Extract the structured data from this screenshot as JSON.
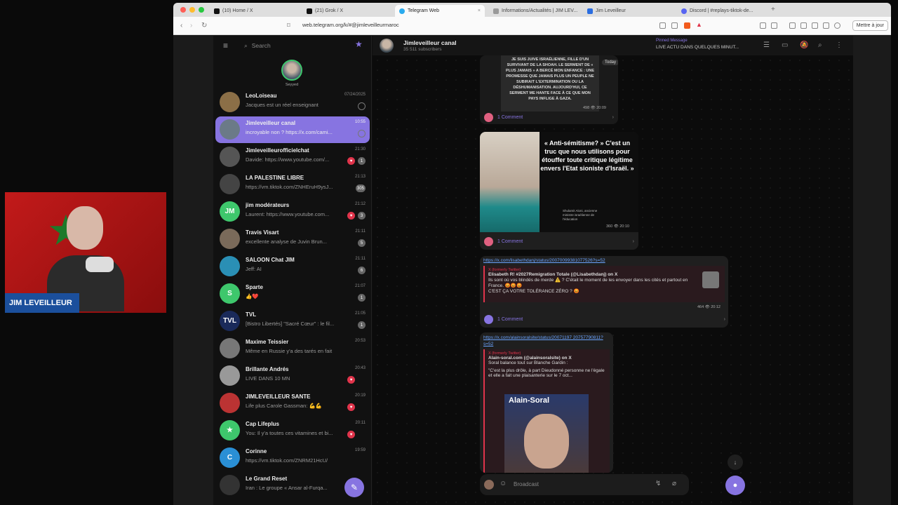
{
  "browser": {
    "tabs": [
      {
        "label": "(10) Home / X"
      },
      {
        "label": "(21) Grok / X"
      },
      {
        "label": "Telegram Web"
      },
      {
        "label": "Informations/Actualités | JIM LEV..."
      },
      {
        "label": "Jim Leveilleur"
      },
      {
        "label": "Discord | #replays-tiktok-de..."
      }
    ],
    "url": "web.telegram.org/k/#@jimleveilleurmaroc",
    "update_label": "Mettre à jour"
  },
  "sidebar": {
    "search_placeholder": "Search",
    "story_label": "Seyyed",
    "chats": [
      {
        "name": "LeoLoiseau",
        "preview": "Jacques est un réel enseignant",
        "time": "07/24/2025",
        "avatar_bg": "#8b6f47",
        "initials": ""
      },
      {
        "name": "Jimleveilleur canal",
        "preview": "incroyable non ? https://x.com/cami...",
        "time": "10:55",
        "avatar_bg": "#6b7a88",
        "initials": ""
      },
      {
        "name": "Jimleveilleurofficielchat",
        "preview": "Davide: https://www.youtube.com/...",
        "time": "21:30",
        "badge": "1",
        "avatar_bg": "#555",
        "initials": ""
      },
      {
        "name": "LA PALESTINE LIBRE",
        "preview": "https://vm.tiktok.com/ZNHEruH9ysJ...",
        "time": "21:13",
        "badge": "305",
        "avatar_bg": "#444",
        "initials": ""
      },
      {
        "name": "jim modérateurs",
        "preview": "Laurent: https://www.youtube.com...",
        "time": "21:12",
        "badge": "3",
        "avatar_bg": "#3ec76c",
        "initials": "JM"
      },
      {
        "name": "Travis Visart",
        "preview": "excellente analyse de Juvin Brun...",
        "time": "21:11",
        "badge": "5",
        "avatar_bg": "#7a6a5a",
        "initials": ""
      },
      {
        "name": "SALOON Chat JIM",
        "preview": "Jeff: AI",
        "time": "21:11",
        "badge": "6",
        "avatar_bg": "#2a8fb5",
        "initials": ""
      },
      {
        "name": "Sparte",
        "preview": "👍❤️",
        "time": "21:07",
        "badge": "1",
        "avatar_bg": "#3ec76c",
        "initials": "S"
      },
      {
        "name": "TVL",
        "preview": "[Bistro Libertés] \"Sacré Cœur\" : le fil...",
        "time": "21:05",
        "badge": "1",
        "avatar_bg": "#1a2a5a",
        "initials": "TVL"
      },
      {
        "name": "Maxime Teissier",
        "preview": "Même en Russie y'a des tarés en fait",
        "time": "20:53",
        "avatar_bg": "#777",
        "initials": ""
      },
      {
        "name": "Brillante Andrés",
        "preview": "LIVE DANS 10 MN",
        "time": "20:43",
        "avatar_bg": "#999",
        "initials": ""
      },
      {
        "name": "JIMLEVEILLEUR SANTE",
        "preview": "Life plus Carole Gassman: 💪💪",
        "time": "20:19",
        "avatar_bg": "#b33",
        "initials": ""
      },
      {
        "name": "Cap Lifeplus",
        "preview": "You: Il y'a toutes ces vitamines et bi...",
        "time": "20:11",
        "avatar_bg": "#3ec76c",
        "initials": "★"
      },
      {
        "name": "Corinne",
        "preview": "https://vm.tiktok.com/ZNRM21HcU/",
        "time": "19:59",
        "avatar_bg": "#2a8fd5",
        "initials": "C"
      },
      {
        "name": "Le Grand Reset",
        "preview": "Iran : Le groupe « Ansar al-Furqa...",
        "time": "",
        "avatar_bg": "#333",
        "initials": ""
      }
    ]
  },
  "header": {
    "title": "Jimleveilleur canal",
    "subtitle": "35 511 subscribers",
    "pinned_label": "Pinned Message",
    "pinned_text": "LIVE ACTU DANS QUELQUES MINUT..."
  },
  "messages": {
    "msg1_text": "JE SUIS JUIVE ISRAÉLIENNE, FILLE D'UN SURVIVANT DE LA SHOAH. LE SERMENT DE « PLUS JAMAIS » A BERCÉ MON ENFANCE : UNE PROMESSE QUE JAMAIS PLUS UN PEUPLE NE SUBIRAIT L'EXTERMINATION OU LA DÉSHUMANISATION. AUJOURD'HUI, CE SERMENT ME HANTE FACE À CE QUE MON PAYS INFLIGE À GAZA.",
    "msg1_meta": "498 👁 20:09",
    "today_badge": "Today",
    "comment1": "1 Comment",
    "msg2_quote": "« Anti-sémitisme? » C'est un truc que nous utilisons pour étouffer toute critique légitime envers l'Etat sioniste d'Israël. »",
    "msg2_author": "Shulamit Aloni, ancienne ministre israélienne de l'éducation",
    "msg2_meta": "360 👁 20:10",
    "comment2": "1 Comment",
    "msg3_link": "https://x.com/lisabethdanj/status/20070099381077526?s=52",
    "msg3_source": "X (formerly Twitter)",
    "msg3_title": "Elisabeth R! #2027Remigration Totale (@Lisabethdanj) on X",
    "msg3_body": "Ils sont où vos blindés de merde ⚠️ ? C'était le moment de les envoyer dans les cités et partout en France. 😡😡😡",
    "msg3_body2": "C'EST ÇA VOTRE TOLÉRANCE ZÉRO ? 😡",
    "msg3_meta": "464 👁 20:12",
    "comment3": "1 Comment",
    "msg4_link": "https://x.com/alainsoralsite/status/20071197 20757790811?s=52",
    "msg4_source": "X (formerly Twitter)",
    "msg4_title": "Alain-soral.com (@alainsoralsite) on X",
    "msg4_body": "Soral balance tout sur Blanche Gardin :",
    "msg4_body2": "\"C'est la plus drôle, à part Dieudonné personne ne l'égale et elle a fait une plaisanterie sur le 7 oct...",
    "msg4_overlay": "Alain-Soral",
    "composer_placeholder": "Broadcast"
  },
  "webcam": {
    "name_label": "JIM LEVEILLEUR"
  },
  "colors": {
    "accent": "#8774e1",
    "heart": "#e0344b",
    "badge_green": "#3ec76c",
    "cam_label_bg": "#1b4f9c"
  }
}
